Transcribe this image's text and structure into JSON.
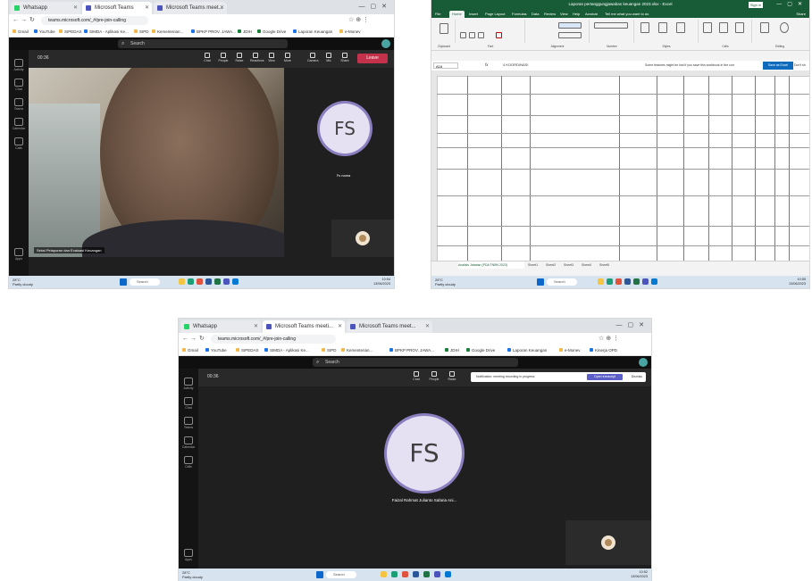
{
  "browser": {
    "tabs": [
      "Whatsapp",
      "Microsoft Teams",
      "Microsoft Teams meet..."
    ],
    "tabs_bottom": [
      "Whatsapp",
      "Microsoft Teams meeti...",
      "Microsoft Teams meet..."
    ],
    "url": "teams.microsoft.com/_#/pre-join-calling",
    "bookmarks": [
      "Gmail",
      "YouTube",
      "SIPEDAS",
      "SIMDA - Aplikasi Ke...",
      "SIPD",
      "Kementerian...",
      "BPKP PROV. JAWA...",
      "JDIH",
      "Google Drive",
      "Laporan Keuangan",
      "e-Monev",
      "Kinerja OPD"
    ]
  },
  "teams": {
    "search_placeholder": "Search",
    "meeting_time": "00:36",
    "toolbar": [
      "Chat",
      "People",
      "Raise",
      "Reactions",
      "View",
      "More",
      "Camera",
      "Mic",
      "Share"
    ],
    "toolbar_bottom": [
      "Chat",
      "People",
      "Raise"
    ],
    "leave_label": "Leave",
    "rail": [
      "Activity",
      "Chat",
      "Teams",
      "Calendar",
      "Calls",
      "Apps"
    ],
    "participant_initials": "FS",
    "participant_name_short": "Fs nama",
    "participant_name_long": "Faizal Rahmat Julianto Safaria Ani...",
    "video_caption": "Seksi Pelaporan dan Evaluasi Keuangan",
    "notice": "Notification: meeting recording in progress",
    "notice_btn": "Open transcript",
    "notice_dismiss": "Dismiss"
  },
  "taskbar": {
    "weather": [
      "28°C",
      "Partly cloudy"
    ],
    "search": "Search",
    "time": "10:54",
    "date": "13/06/2023",
    "time_b": "10:55",
    "time_c": "10:52"
  },
  "excel": {
    "title": "Laporan pertanggungjawaban keuangan 2023.xlsx - Excel",
    "signin": "Sign in",
    "tabs": [
      "File",
      "Home",
      "Insert",
      "Page Layout",
      "Formulas",
      "Data",
      "Review",
      "View",
      "Help",
      "Acrobat",
      "Tell me what you want to do"
    ],
    "share": "Share",
    "ribbon_groups": [
      "Clipboard",
      "Font",
      "Alignment",
      "Number",
      "Styles",
      "Cells",
      "Editing"
    ],
    "namebox": "A16",
    "fx": "fx",
    "formula": "4 KOORDINASI",
    "notice": "Some features might be lost if you save this workbook in the comma-delimited format",
    "notice_btn": "Save as Excel Workbook",
    "notice_dismiss": "Don't show again",
    "sheets": [
      "Analisis Jabatan (PDA TNBN 2023)",
      "Sheet1",
      "Sheet2",
      "Sheet3",
      "Sheet4",
      "Sheet5"
    ]
  }
}
